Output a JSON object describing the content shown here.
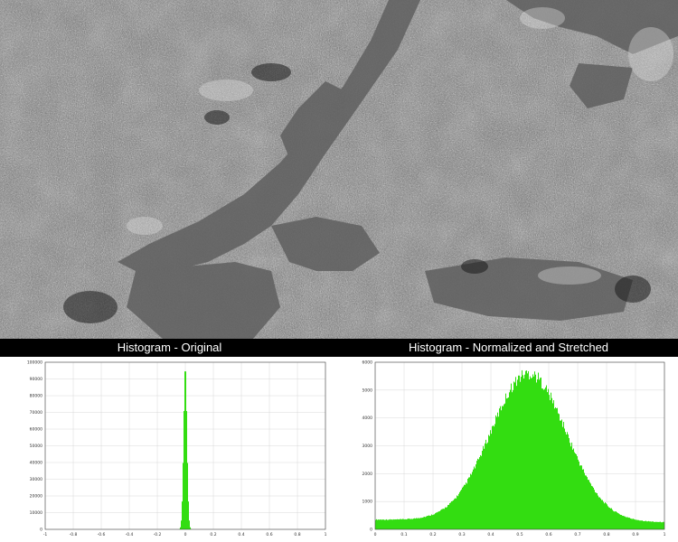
{
  "panels": {
    "left_title": "Histogram - Original",
    "right_title": "Histogram - Normalized and Stretched"
  },
  "image": {
    "description_icon": "satellite-radar-image"
  },
  "colors": {
    "bars": "#33dd11",
    "grid": "#d8d8d8",
    "axis": "#444444",
    "header_bg": "#000000",
    "header_text": "#ffffff"
  },
  "chart_data": [
    {
      "type": "bar",
      "title": "Histogram - Original",
      "xlabel": "",
      "ylabel": "",
      "xlim": [
        -1,
        1
      ],
      "ylim": [
        0,
        100000
      ],
      "x_ticks": [
        "-1",
        "-0.8",
        "-0.6",
        "-0.4",
        "-0.2",
        "0",
        "0.2",
        "0.4",
        "0.6",
        "0.8",
        "1"
      ],
      "y_ticks": [
        "0",
        "10000",
        "20000",
        "30000",
        "40000",
        "50000",
        "60000",
        "70000",
        "80000",
        "90000",
        "100000"
      ],
      "grid": true,
      "distribution": {
        "shape": "spike",
        "center": 0.0,
        "width": 0.012,
        "peak": 98000
      }
    },
    {
      "type": "bar",
      "title": "Histogram - Normalized and Stretched",
      "xlabel": "",
      "ylabel": "",
      "xlim": [
        0,
        1
      ],
      "ylim": [
        0,
        6000
      ],
      "x_ticks": [
        "0",
        "0.1",
        "0.2",
        "0.3",
        "0.4",
        "0.5",
        "0.6",
        "0.7",
        "0.8",
        "0.9",
        "1"
      ],
      "y_ticks": [
        "0",
        "1000",
        "2000",
        "3000",
        "4000",
        "5000",
        "6000"
      ],
      "grid": true,
      "distribution": {
        "shape": "gaussian",
        "center": 0.53,
        "sigma": 0.13,
        "peak": 5600,
        "baseline_left": 350,
        "baseline_right": 250
      }
    }
  ]
}
